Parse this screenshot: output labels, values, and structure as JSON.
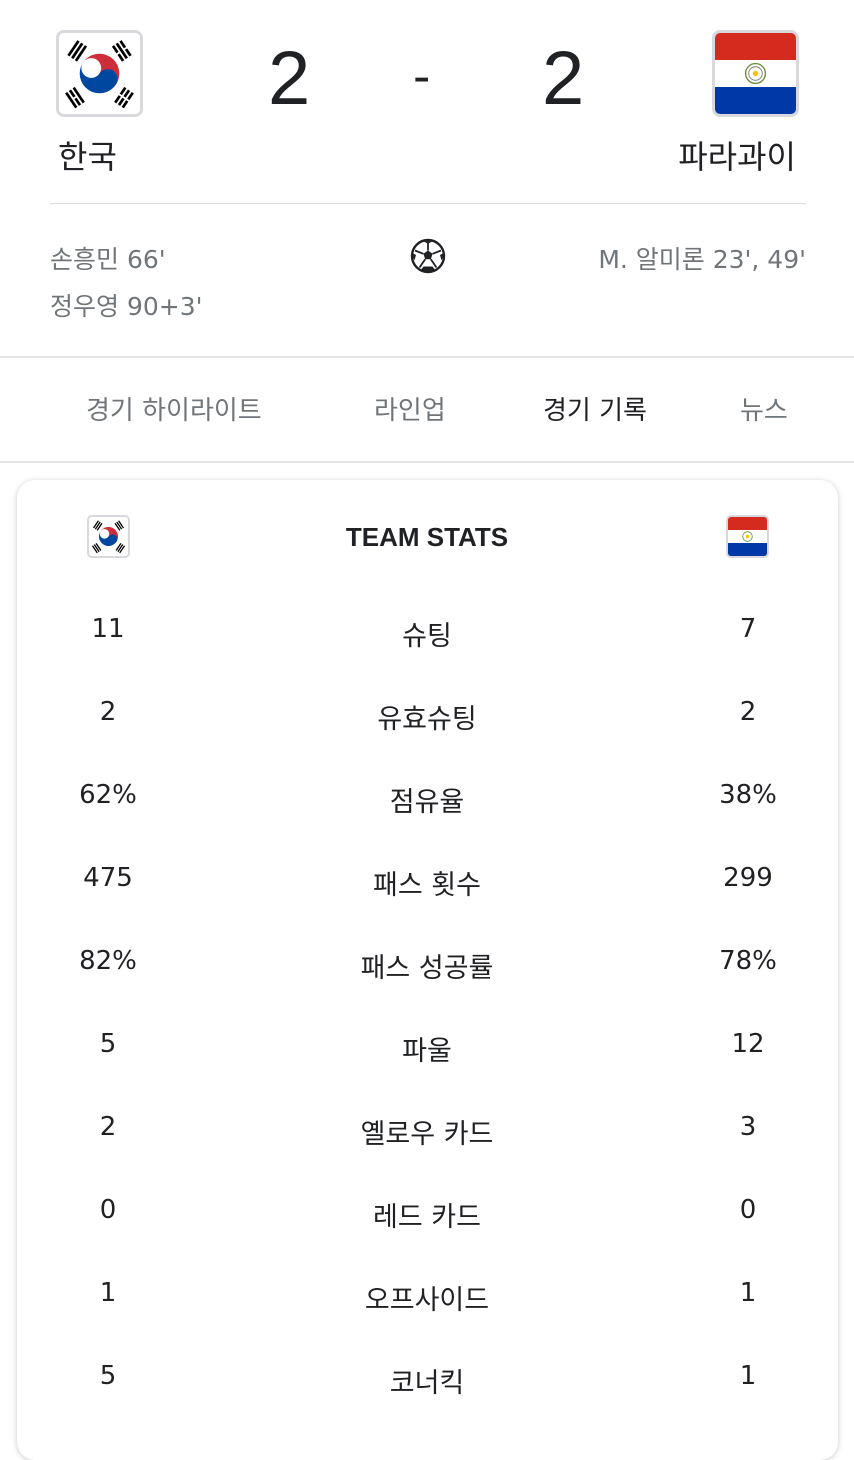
{
  "match": {
    "home": {
      "name": "한국",
      "score": "2"
    },
    "away": {
      "name": "파라과이",
      "score": "2"
    },
    "separator": "-",
    "home_scorers": [
      "손흥민 66'",
      "정우영 90+3'"
    ],
    "away_scorers": [
      "M. 알미론 23', 49'"
    ]
  },
  "tabs": [
    {
      "label": "경기 하이라이트",
      "active": false
    },
    {
      "label": "라인업",
      "active": false
    },
    {
      "label": "경기 기록",
      "active": true
    },
    {
      "label": "뉴스",
      "active": false
    }
  ],
  "stats": {
    "title": "TEAM STATS",
    "rows": [
      {
        "home": "11",
        "label": "슈팅",
        "away": "7"
      },
      {
        "home": "2",
        "label": "유효슈팅",
        "away": "2"
      },
      {
        "home": "62%",
        "label": "점유율",
        "away": "38%"
      },
      {
        "home": "475",
        "label": "패스 횟수",
        "away": "299"
      },
      {
        "home": "82%",
        "label": "패스 성공률",
        "away": "78%"
      },
      {
        "home": "5",
        "label": "파울",
        "away": "12"
      },
      {
        "home": "2",
        "label": "옐로우 카드",
        "away": "3"
      },
      {
        "home": "0",
        "label": "레드 카드",
        "away": "0"
      },
      {
        "home": "1",
        "label": "오프사이드",
        "away": "1"
      },
      {
        "home": "5",
        "label": "코너킥",
        "away": "1"
      }
    ]
  },
  "colors": {
    "text": "#202124",
    "muted": "#70757a",
    "korea_red": "#cd2e3a",
    "korea_blue": "#0047a0",
    "paraguay_red": "#d52b1e",
    "paraguay_blue": "#0038a8"
  },
  "icons": {
    "goal": "soccer-ball-icon"
  }
}
